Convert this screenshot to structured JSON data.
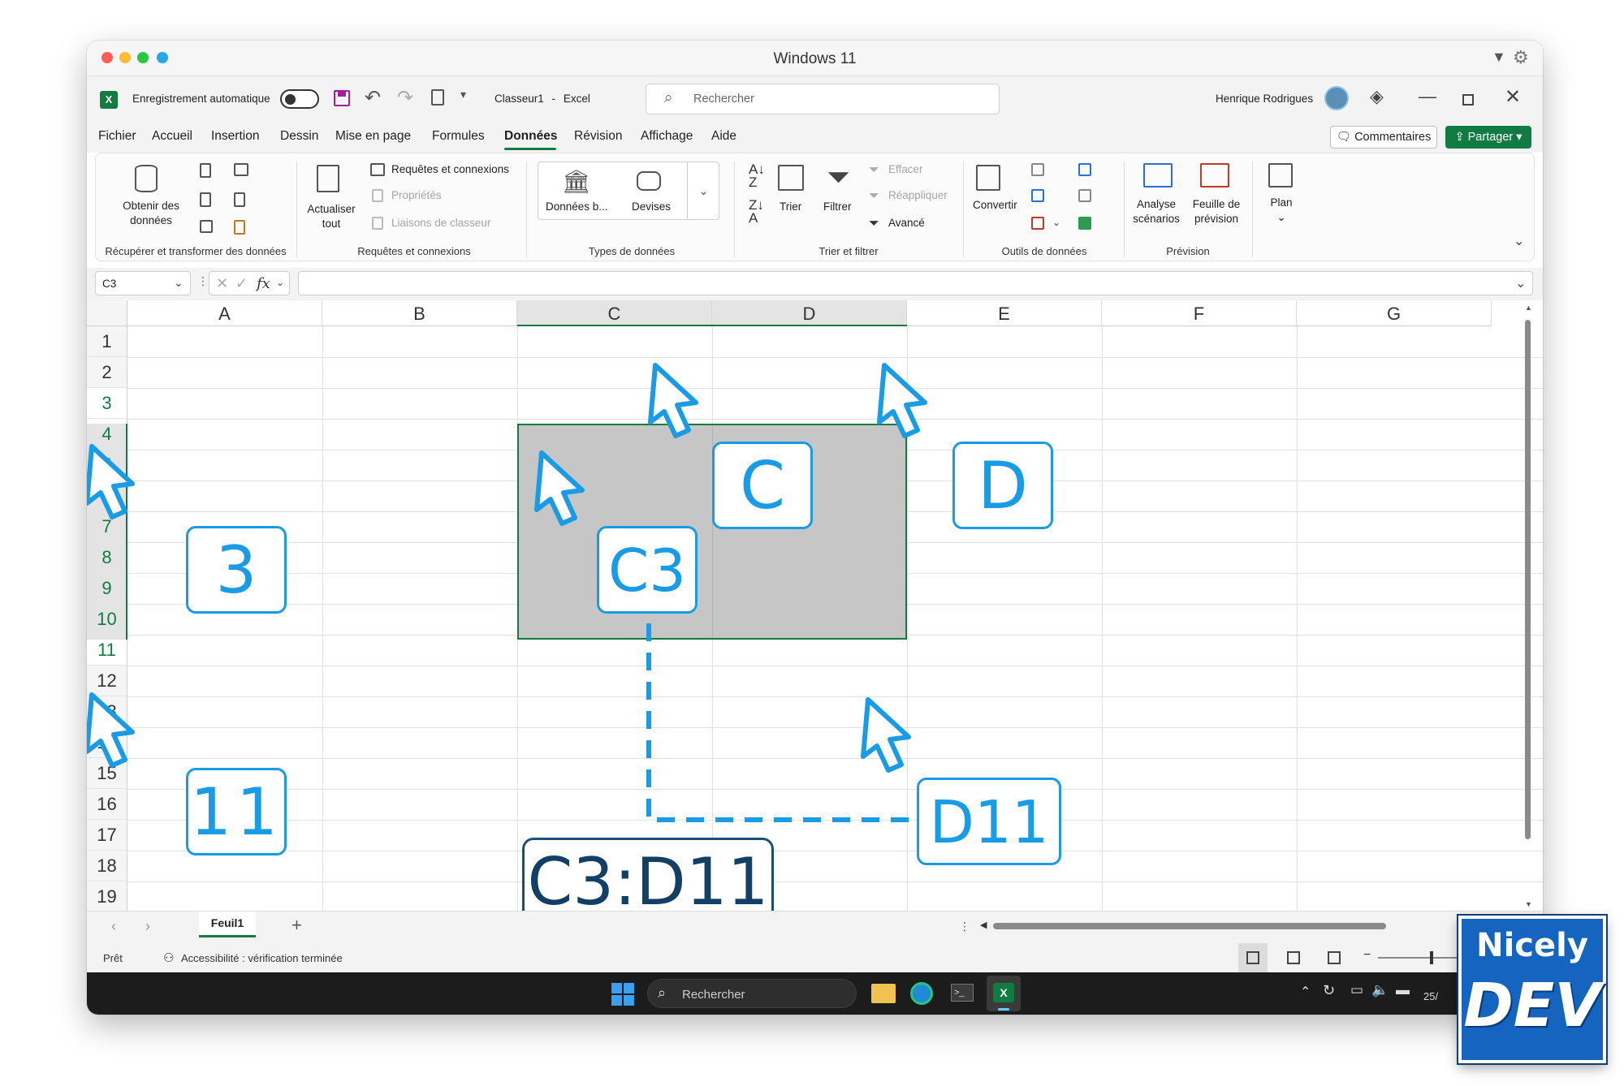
{
  "mac": {
    "title": "Windows 11"
  },
  "titlebar": {
    "autosave_label": "Enregistrement automatique",
    "doc_title": "Classeur1",
    "app_name": "Excel",
    "search_placeholder": "Rechercher",
    "user_name": "Henrique Rodrigues"
  },
  "menu": {
    "items": [
      "Fichier",
      "Accueil",
      "Insertion",
      "Dessin",
      "Mise en page",
      "Formules",
      "Données",
      "Révision",
      "Affichage",
      "Aide"
    ],
    "comments_label": "Commentaires",
    "share_label": "Partager"
  },
  "ribbon": {
    "get_data_1": "Obtenir des",
    "get_data_2": "données",
    "group1": "Récupérer et transformer des données",
    "refresh_1": "Actualiser",
    "refresh_2": "tout",
    "queries_conn": "Requêtes et connexions",
    "properties": "Propriétés",
    "workbook_links": "Liaisons de classeur",
    "group2": "Requêtes et connexions",
    "stocks": "Données b...",
    "currencies": "Devises",
    "group3": "Types de données",
    "sort": "Trier",
    "filter": "Filtrer",
    "clear": "Effacer",
    "reapply": "Réappliquer",
    "advanced": "Avancé",
    "group4": "Trier et filtrer",
    "convert": "Convertir",
    "group5": "Outils de données",
    "whatif_1": "Analyse",
    "whatif_2": "scénarios",
    "forecast_1": "Feuille de",
    "forecast_2": "prévision",
    "group6": "Prévision",
    "outline": "Plan"
  },
  "formula_bar": {
    "name_box": "C3",
    "fx": "fx",
    "value": ""
  },
  "grid": {
    "columns": [
      "A",
      "B",
      "C",
      "D",
      "E",
      "F",
      "G"
    ],
    "rows": [
      "1",
      "2",
      "3",
      "4",
      "5",
      "6",
      "7",
      "8",
      "9",
      "10",
      "11",
      "12",
      "13",
      "14",
      "15",
      "16",
      "17",
      "18",
      "19"
    ]
  },
  "sheet": {
    "tab": "Feuil1",
    "add": "+"
  },
  "status": {
    "ready": "Prêt",
    "accessibility": "Accessibilité : vérification terminée"
  },
  "taskbar": {
    "search": "Rechercher",
    "date_partial": "25/"
  },
  "callouts": {
    "row_start": "3",
    "row_end": "11",
    "col_c": "C",
    "col_d": "D",
    "cell_start": "C3",
    "cell_end": "D11",
    "range": "C3:D11"
  },
  "brand": {
    "line1": "Nicely",
    "line2": "DEV"
  },
  "colors": {
    "accent": "#1a9be6",
    "excel_green": "#107c41",
    "selection": "#c6c6c6",
    "brand_blue": "#1565c0"
  }
}
